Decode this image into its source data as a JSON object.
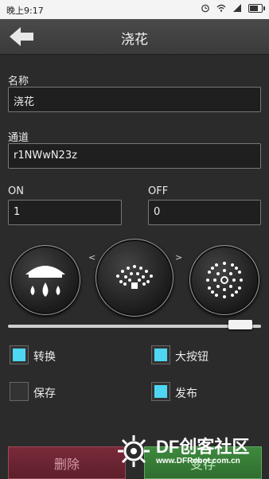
{
  "status_bar": {
    "time": "晚上9:17"
  },
  "toolbar": {
    "title": "浇花"
  },
  "form": {
    "name_label": "名称",
    "name_value": "浇花",
    "channel_label": "通道",
    "channel_value": "r1NWwN23z",
    "on_label": "ON",
    "on_value": "1",
    "off_label": "OFF",
    "off_value": "0"
  },
  "icon_selector": {
    "prev_symbol": "<",
    "next_symbol": ">",
    "items": [
      "shower-icon",
      "sprinkler-icon",
      "firework-icon"
    ]
  },
  "slider": {
    "value": 0.92
  },
  "options": {
    "convert_label": "转换",
    "convert_checked": true,
    "big_button_label": "大按钮",
    "big_button_checked": true,
    "save_label": "保存",
    "save_checked": false,
    "publish_label": "发布",
    "publish_checked": true
  },
  "buttons": {
    "delete_label": "删除",
    "save_label": "变存"
  },
  "watermark": {
    "logo_text": "DF创客社区",
    "url": "www.DFRobot.com.cn"
  },
  "colors": {
    "check": "#4fd6f2",
    "delete": "#6a2432",
    "save": "#347a34"
  }
}
